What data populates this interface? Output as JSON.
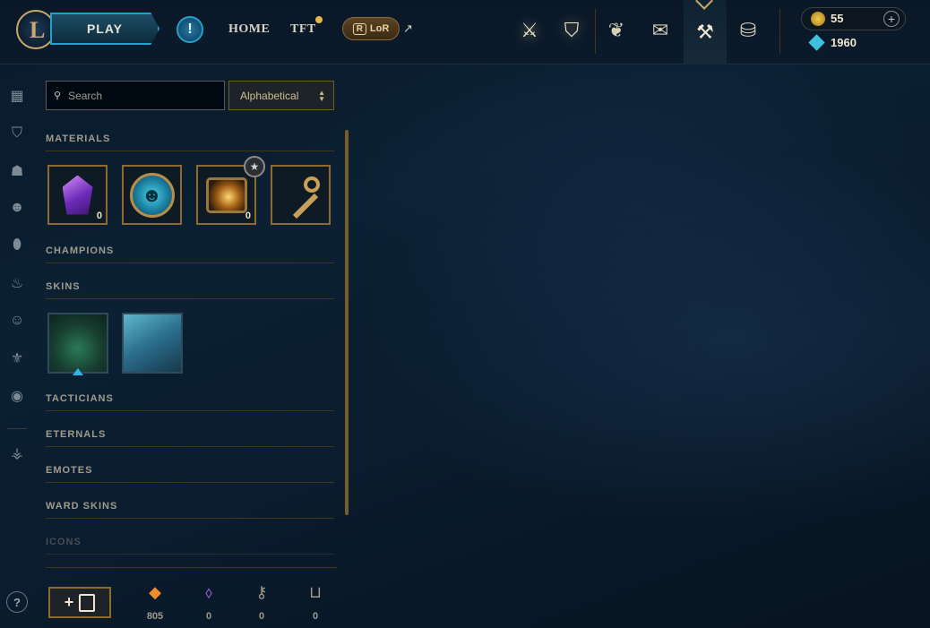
{
  "header": {
    "logo_letter": "L",
    "play_label": "PLAY",
    "alert_glyph": "!",
    "nav": {
      "home": "HOME",
      "tft": "TFT"
    },
    "lor_label": "LoR",
    "lor_letter": "R",
    "icons": [
      "worlds-icon",
      "collection-icon",
      "clash-icon",
      "loot-bag-icon",
      "crafting-icon",
      "store-icon"
    ],
    "active_tab": "crafting-icon",
    "currency": {
      "rp": "55",
      "blue_essence": "1960"
    }
  },
  "sidebar": {
    "icons": [
      "grid-icon",
      "chest-icon",
      "champion-helmet-icon",
      "mask-icon",
      "ward-icon",
      "flame-icon",
      "emote-face-icon",
      "tft-icon",
      "profile-icon",
      "eternals-icon"
    ]
  },
  "controls": {
    "search_placeholder": "Search",
    "sort_value": "Alphabetical"
  },
  "sections": {
    "materials": "MATERIALS",
    "champions": "CHAMPIONS",
    "skins": "SKINS",
    "tacticians": "TACTICIANS",
    "eternals": "ETERNALS",
    "emotes": "EMOTES",
    "ward_skins": "WARD SKINS",
    "icons": "ICONS"
  },
  "materials": [
    {
      "name": "mythic-essence",
      "count": "0"
    },
    {
      "name": "emote-coin",
      "count": ""
    },
    {
      "name": "hextech-chest",
      "count": "0"
    },
    {
      "name": "key",
      "count": ""
    }
  ],
  "footer": {
    "resources": [
      {
        "name": "orange-essence",
        "value": "805",
        "color": "#f28c28",
        "glyph": "◆"
      },
      {
        "name": "mythic-essence",
        "value": "0",
        "color": "#a061e0",
        "glyph": "⬨"
      },
      {
        "name": "key-fragment",
        "value": "0",
        "color": "#a09b8c",
        "glyph": "⚷"
      },
      {
        "name": "chest",
        "value": "0",
        "color": "#a09b8c",
        "glyph": "⊔"
      }
    ],
    "add_glyph": "+",
    "help_glyph": "?"
  }
}
